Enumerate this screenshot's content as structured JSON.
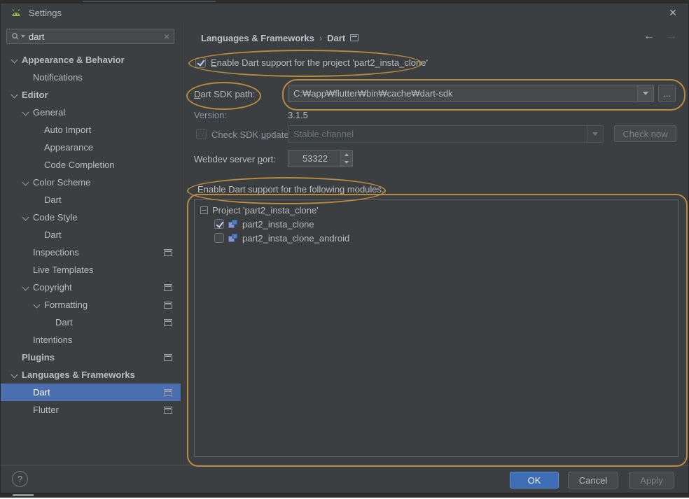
{
  "chrome": {
    "title": "Settings",
    "close": "×",
    "help": "?"
  },
  "search": {
    "value": "dart",
    "clear": "×"
  },
  "sidebar": {
    "items": [
      {
        "label": "Appearance & Behavior",
        "level": 0,
        "bold": true,
        "chevron": true
      },
      {
        "label": "Notifications",
        "level": 1
      },
      {
        "label": "Editor",
        "level": 0,
        "bold": true,
        "chevron": true
      },
      {
        "label": "General",
        "level": 1,
        "chevron": true
      },
      {
        "label": "Auto Import",
        "level": 2
      },
      {
        "label": "Appearance",
        "level": 2
      },
      {
        "label": "Code Completion",
        "level": 2
      },
      {
        "label": "Color Scheme",
        "level": 1,
        "chevron": true
      },
      {
        "label": "Dart",
        "level": 2
      },
      {
        "label": "Code Style",
        "level": 1,
        "chevron": true
      },
      {
        "label": "Dart",
        "level": 2
      },
      {
        "label": "Inspections",
        "level": 1,
        "gear": true
      },
      {
        "label": "Live Templates",
        "level": 1
      },
      {
        "label": "Copyright",
        "level": 1,
        "chevron": true,
        "gear": true
      },
      {
        "label": "Formatting",
        "level": 2,
        "chevron": true,
        "gear": true
      },
      {
        "label": "Dart",
        "level": 3,
        "gear": true
      },
      {
        "label": "Intentions",
        "level": 1
      },
      {
        "label": "Plugins",
        "level": 0,
        "bold": true,
        "gear": true
      },
      {
        "label": "Languages & Frameworks",
        "level": 0,
        "bold": true,
        "chevron": true
      },
      {
        "label": "Dart",
        "level": 1,
        "selected": true,
        "gear": true
      },
      {
        "label": "Flutter",
        "level": 1,
        "gear": true
      }
    ]
  },
  "header": {
    "breadcrumb": [
      "Languages & Frameworks",
      "Dart"
    ],
    "separator": "›",
    "back": "←",
    "forward": "→"
  },
  "content": {
    "enable_project": {
      "parts": [
        "",
        "E",
        "nable Dart support for the project 'part2_insta_clone'"
      ],
      "checked": true
    },
    "sdk_path": {
      "label_parts": [
        "",
        "D",
        "art SDK path:"
      ],
      "value": "C:₩app₩flutter₩bin₩cache₩dart-sdk",
      "browse": "..."
    },
    "version": {
      "label": "Version:",
      "value": "3.1.5"
    },
    "sdk_update": {
      "label_parts": [
        "Check SDK ",
        "u",
        "pdate:"
      ],
      "channel": "Stable channel",
      "check_now": "Check now",
      "checked": false
    },
    "webdev_port": {
      "label_parts": [
        "Webdev server ",
        "p",
        "ort:"
      ],
      "value": "53322"
    },
    "modules": {
      "label": "Enable Dart support for the following modules:",
      "project_label": "Project 'part2_insta_clone'",
      "items": [
        {
          "label": "part2_insta_clone",
          "checked": true
        },
        {
          "label": "part2_insta_clone_android",
          "checked": false
        }
      ]
    }
  },
  "footer": {
    "ok": "OK",
    "cancel": "Cancel",
    "apply": "Apply"
  },
  "colors": {
    "selection": "#4b6eaf",
    "annotation": "#bf8e3f",
    "ok_button": "#3d6db5",
    "window_bg": "#3c3f41"
  }
}
